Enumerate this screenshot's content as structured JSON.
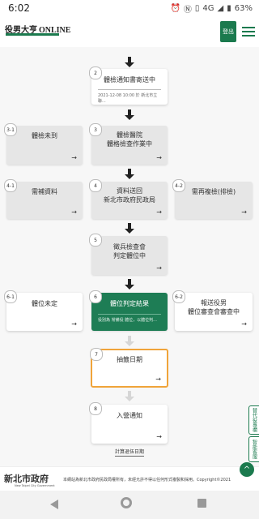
{
  "status_bar": {
    "time": "6:02",
    "signal": "4G",
    "battery": "63%"
  },
  "header": {
    "logo_cn": "役男大亨",
    "logo_en": "ONLINE",
    "login_label": "登出",
    "menu_icon": "hamburger-icon"
  },
  "flow": {
    "cta_symbol": "→",
    "steps": [
      {
        "id": "2",
        "title": "體檢通知書寄送中",
        "sub": "2021-12-08 10:00 於 新北市立聯..."
      },
      {
        "id": "3-1",
        "title": "體檢未到"
      },
      {
        "id": "3",
        "title": "體檢醫院\n體格檢查作業中"
      },
      {
        "id": "4-1",
        "title": "需補資料"
      },
      {
        "id": "4",
        "title": "資料送回\n新北市政府民政局"
      },
      {
        "id": "4-2",
        "title": "需再複檢(排檢)"
      },
      {
        "id": "5",
        "title": "徵兵檢查會\n判定體位中"
      },
      {
        "id": "6-1",
        "title": "體位未定"
      },
      {
        "id": "6",
        "title": "體位判定結果",
        "sub": "役別為 常備役 體位，以體位判..."
      },
      {
        "id": "6-2",
        "title": "報送役男\n體位審查會審查中"
      },
      {
        "id": "7",
        "title": "抽籤日期"
      },
      {
        "id": "8",
        "title": "入營通知"
      }
    ],
    "footer_link": "計算退伍日期"
  },
  "side_tabs": {
    "tab1": "替代役專欄",
    "tab2": "智能客服"
  },
  "footer": {
    "logo_cn": "新北市政府",
    "logo_en": "New Taipei City Government",
    "copyright": "本網站為新北市政府民政局權所有，未經允許不得以任何形式複製和採用。Copyright©2021",
    "top_button": "^"
  }
}
